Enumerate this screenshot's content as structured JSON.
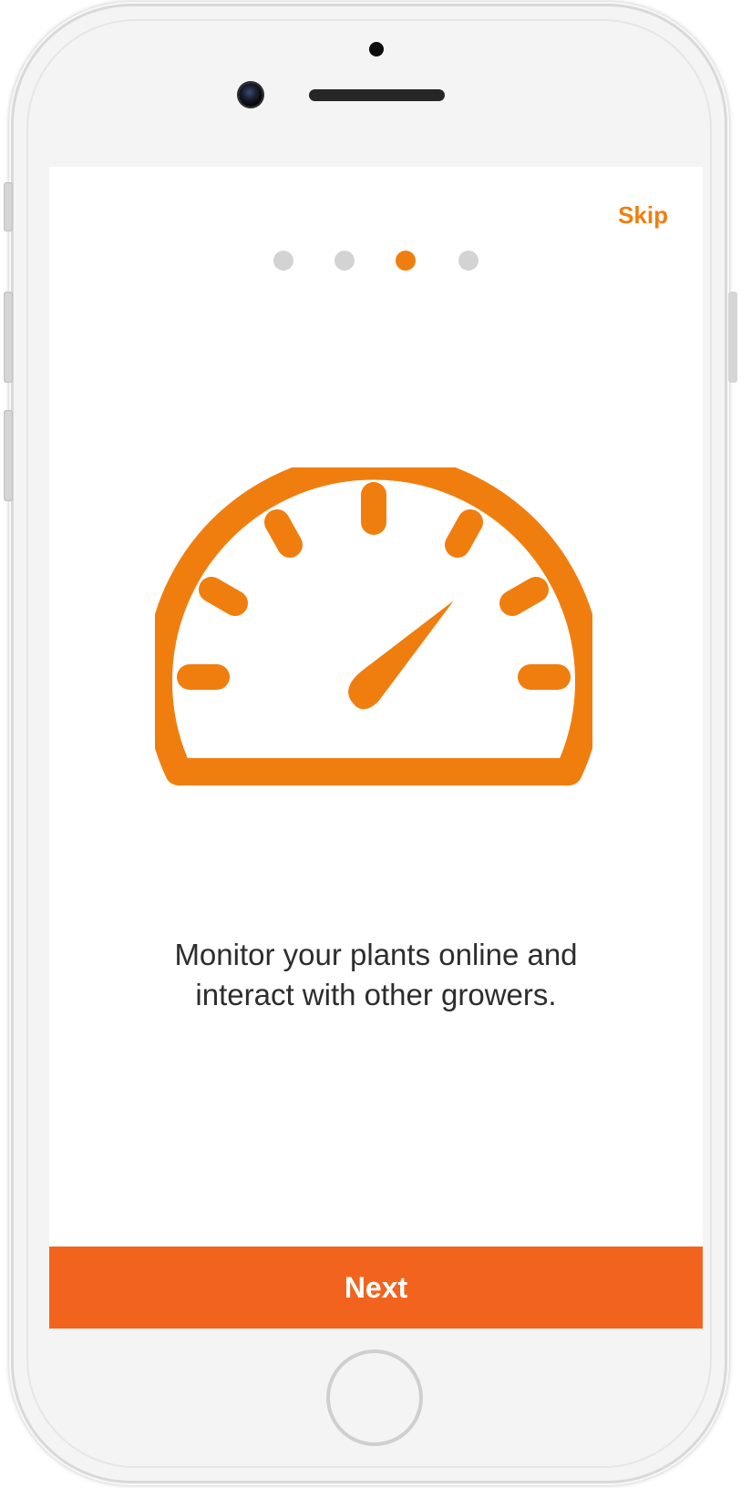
{
  "onboarding": {
    "skip_label": "Skip",
    "pager": {
      "total": 4,
      "active_index": 3
    },
    "illustration_icon": "speedometer-icon",
    "message_line1": "Monitor your plants online and",
    "message_line2": "interact with other growers.",
    "next_label": "Next"
  },
  "colors": {
    "accent": "#f07e0f",
    "button": "#f2641d",
    "dot_inactive": "#d3d3d3",
    "text": "#2d2d2d"
  }
}
